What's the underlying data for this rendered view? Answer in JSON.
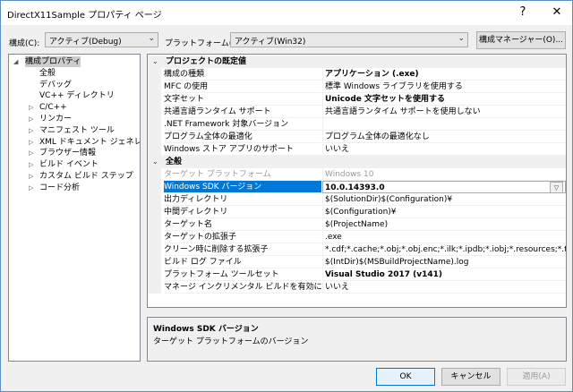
{
  "window": {
    "title": "DirectX11Sample プロパティ ページ",
    "help_glyph": "?",
    "close_glyph": "✕"
  },
  "toolbar": {
    "config_label": "構成(C):",
    "config_value": "アクティブ(Debug)",
    "platform_label": "プラットフォーム(P):",
    "platform_value": "アクティブ(Win32)",
    "manager_button": "構成マネージャー(O)..."
  },
  "tree": {
    "items": [
      {
        "label": "構成プロパティ",
        "expander": "◢"
      },
      {
        "label": "全般"
      },
      {
        "label": "デバッグ"
      },
      {
        "label": "VC++ ディレクトリ"
      },
      {
        "label": "C/C++",
        "expander": "▷"
      },
      {
        "label": "リンカー",
        "expander": "▷"
      },
      {
        "label": "マニフェスト ツール",
        "expander": "▷"
      },
      {
        "label": "XML ドキュメント ジェネレーター",
        "expander": "▷"
      },
      {
        "label": "ブラウザー情報",
        "expander": "▷"
      },
      {
        "label": "ビルド イベント",
        "expander": "▷"
      },
      {
        "label": "カスタム ビルド ステップ",
        "expander": "▷"
      },
      {
        "label": "コード分析",
        "expander": "▷"
      }
    ]
  },
  "grid": {
    "categories": [
      {
        "title": "プロジェクトの既定値",
        "rows": [
          {
            "name": "構成の種類",
            "value": "アプリケーション (.exe)",
            "bold": true
          },
          {
            "name": "MFC の使用",
            "value": "標準 Windows ライブラリを使用する"
          },
          {
            "name": "文字セット",
            "value": "Unicode 文字セットを使用する",
            "bold": true
          },
          {
            "name": "共通言語ランタイム サポート",
            "value": "共通言語ランタイム サポートを使用しない"
          },
          {
            "name": ".NET Framework 対象バージョン",
            "value": ""
          },
          {
            "name": "プログラム全体の最適化",
            "value": "プログラム全体の最適化なし"
          },
          {
            "name": "Windows ストア アプリのサポート",
            "value": "いいえ"
          }
        ]
      },
      {
        "title": "全般",
        "rows": [
          {
            "name": "ターゲット プラットフォーム",
            "value": "Windows 10",
            "gray": true
          },
          {
            "name": "Windows SDK バージョン",
            "value": "10.0.14393.0",
            "selected": true
          },
          {
            "name": "出力ディレクトリ",
            "value": "$(SolutionDir)$(Configuration)¥"
          },
          {
            "name": "中間ディレクトリ",
            "value": "$(Configuration)¥"
          },
          {
            "name": "ターゲット名",
            "value": "$(ProjectName)"
          },
          {
            "name": "ターゲットの拡張子",
            "value": ".exe"
          },
          {
            "name": "クリーン時に削除する拡張子",
            "value": "*.cdf;*.cache;*.obj;*.obj.enc;*.ilk;*.ipdb;*.iobj;*.resources;*.tlb;*.tli;"
          },
          {
            "name": "ビルド ログ ファイル",
            "value": "$(IntDir)$(MSBuildProjectName).log"
          },
          {
            "name": "プラットフォーム ツールセット",
            "value": "Visual Studio 2017 (v141)",
            "bold": true
          },
          {
            "name": "マネージ インクリメンタル ビルドを有効にする",
            "value": "いいえ"
          }
        ]
      }
    ]
  },
  "description": {
    "title": "Windows SDK バージョン",
    "text": "ターゲット プラットフォームのバージョン"
  },
  "buttons": {
    "ok": "OK",
    "cancel": "キャンセル",
    "apply": "適用(A)"
  },
  "colors": {
    "accent": "#0078d7",
    "window_border": "#5a8fc8"
  }
}
